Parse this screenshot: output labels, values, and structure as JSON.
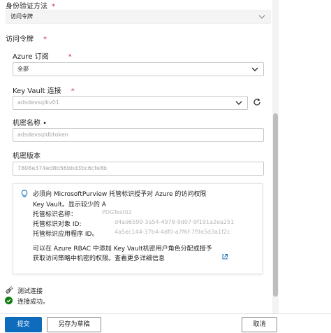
{
  "auth": {
    "label": "身份验证方法",
    "required": "*",
    "selected": "访问令牌"
  },
  "token": {
    "label": "访问令牌",
    "required": "*"
  },
  "subscription": {
    "label": "Azure 订阅",
    "required": "*",
    "selected": "全部"
  },
  "keyvault": {
    "label": "Key Vault 连接",
    "required": "*",
    "placeholder": "adsdevsqlkv01"
  },
  "secret_name": {
    "label": "机密名称 •",
    "placeholder": "adsdevsqldbtoken"
  },
  "secret_version": {
    "label": "机密版本",
    "placeholder": "7808e374ed8b56bbd3bc6cfe8b"
  },
  "info": {
    "line1": "必须向 MicrosoftPurview 托管标识授予对 Azure 的访问权限",
    "line2": "Key Vault。显示较少的 A",
    "name_label": "托管标识名称：",
    "name_value": "PDGTest02",
    "object_label": "托管标识对象 ID:",
    "object_value": "d4ad6599-3a54-4978-9d07-9f191a2ea251",
    "app_label": "托管标识应用程序 ID。",
    "app_value": "4a5ec144-37b4-4df0-a7f6f-7f9a5d3a1f2c",
    "para1": "可以在 Azure RBAC 中添加 Key Vault机密用户角色分配或授予",
    "para2": "获取访问策略中机密的权限。查看更多详细信息"
  },
  "test": {
    "label": "测试连接",
    "status": "连接成功。"
  },
  "buttons": {
    "submit": "提交",
    "save_draft": "另存为草稿",
    "cancel": "取消"
  },
  "colors": {
    "primary": "#0f6cbd",
    "success": "#107c10",
    "required": "#c4314b"
  }
}
